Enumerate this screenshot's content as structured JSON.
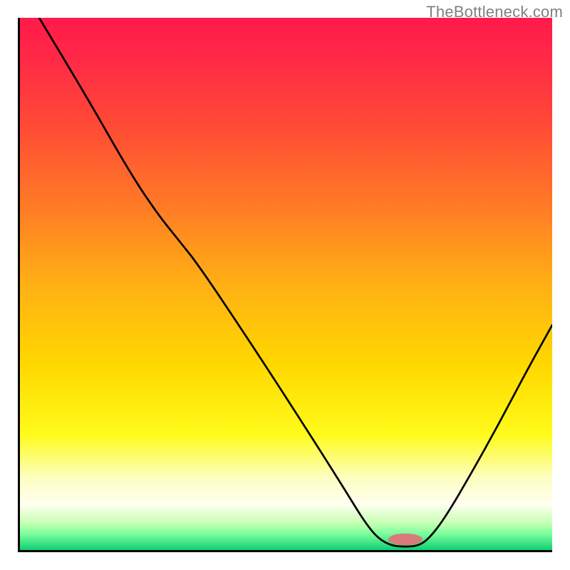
{
  "attribution": "TheBottleneck.com",
  "chart_data": {
    "type": "line",
    "title": "",
    "xlabel": "",
    "ylabel": "",
    "xlim": [
      0,
      100
    ],
    "ylim": [
      0,
      100
    ],
    "grid": false,
    "legend": false,
    "gradient_stops": [
      {
        "offset": 0.0,
        "color": "#ff1a4a"
      },
      {
        "offset": 0.08,
        "color": "#ff2a46"
      },
      {
        "offset": 0.2,
        "color": "#ff4a36"
      },
      {
        "offset": 0.35,
        "color": "#ff7a26"
      },
      {
        "offset": 0.5,
        "color": "#ffb014"
      },
      {
        "offset": 0.65,
        "color": "#ffd800"
      },
      {
        "offset": 0.78,
        "color": "#fffb1a"
      },
      {
        "offset": 0.86,
        "color": "#fdfec0"
      },
      {
        "offset": 0.91,
        "color": "#fffff0"
      },
      {
        "offset": 0.945,
        "color": "#c8ffb4"
      },
      {
        "offset": 0.965,
        "color": "#7dff9c"
      },
      {
        "offset": 1.0,
        "color": "#00c86f"
      }
    ],
    "series": [
      {
        "name": "bottleneck-curve",
        "color": "#000000",
        "stroke_width": 2.7,
        "points": [
          {
            "x": 4.0,
            "y": 100.0
          },
          {
            "x": 13.0,
            "y": 85.0
          },
          {
            "x": 21.0,
            "y": 71.0
          },
          {
            "x": 26.0,
            "y": 63.5
          },
          {
            "x": 30.0,
            "y": 58.5
          },
          {
            "x": 34.0,
            "y": 53.5
          },
          {
            "x": 45.0,
            "y": 37.0
          },
          {
            "x": 55.0,
            "y": 21.5
          },
          {
            "x": 61.0,
            "y": 12.0
          },
          {
            "x": 65.0,
            "y": 5.5
          },
          {
            "x": 67.5,
            "y": 2.5
          },
          {
            "x": 70.0,
            "y": 1.2
          },
          {
            "x": 72.5,
            "y": 1.0
          },
          {
            "x": 75.0,
            "y": 1.2
          },
          {
            "x": 77.0,
            "y": 2.6
          },
          {
            "x": 80.0,
            "y": 6.5
          },
          {
            "x": 85.0,
            "y": 15.0
          },
          {
            "x": 90.0,
            "y": 24.0
          },
          {
            "x": 95.0,
            "y": 33.5
          },
          {
            "x": 100.0,
            "y": 42.5
          }
        ]
      }
    ],
    "marker": {
      "name": "optimal-marker",
      "x": 72.5,
      "y": 2.4,
      "rx": 3.2,
      "ry": 1.1,
      "fill": "#d97b7b"
    }
  }
}
